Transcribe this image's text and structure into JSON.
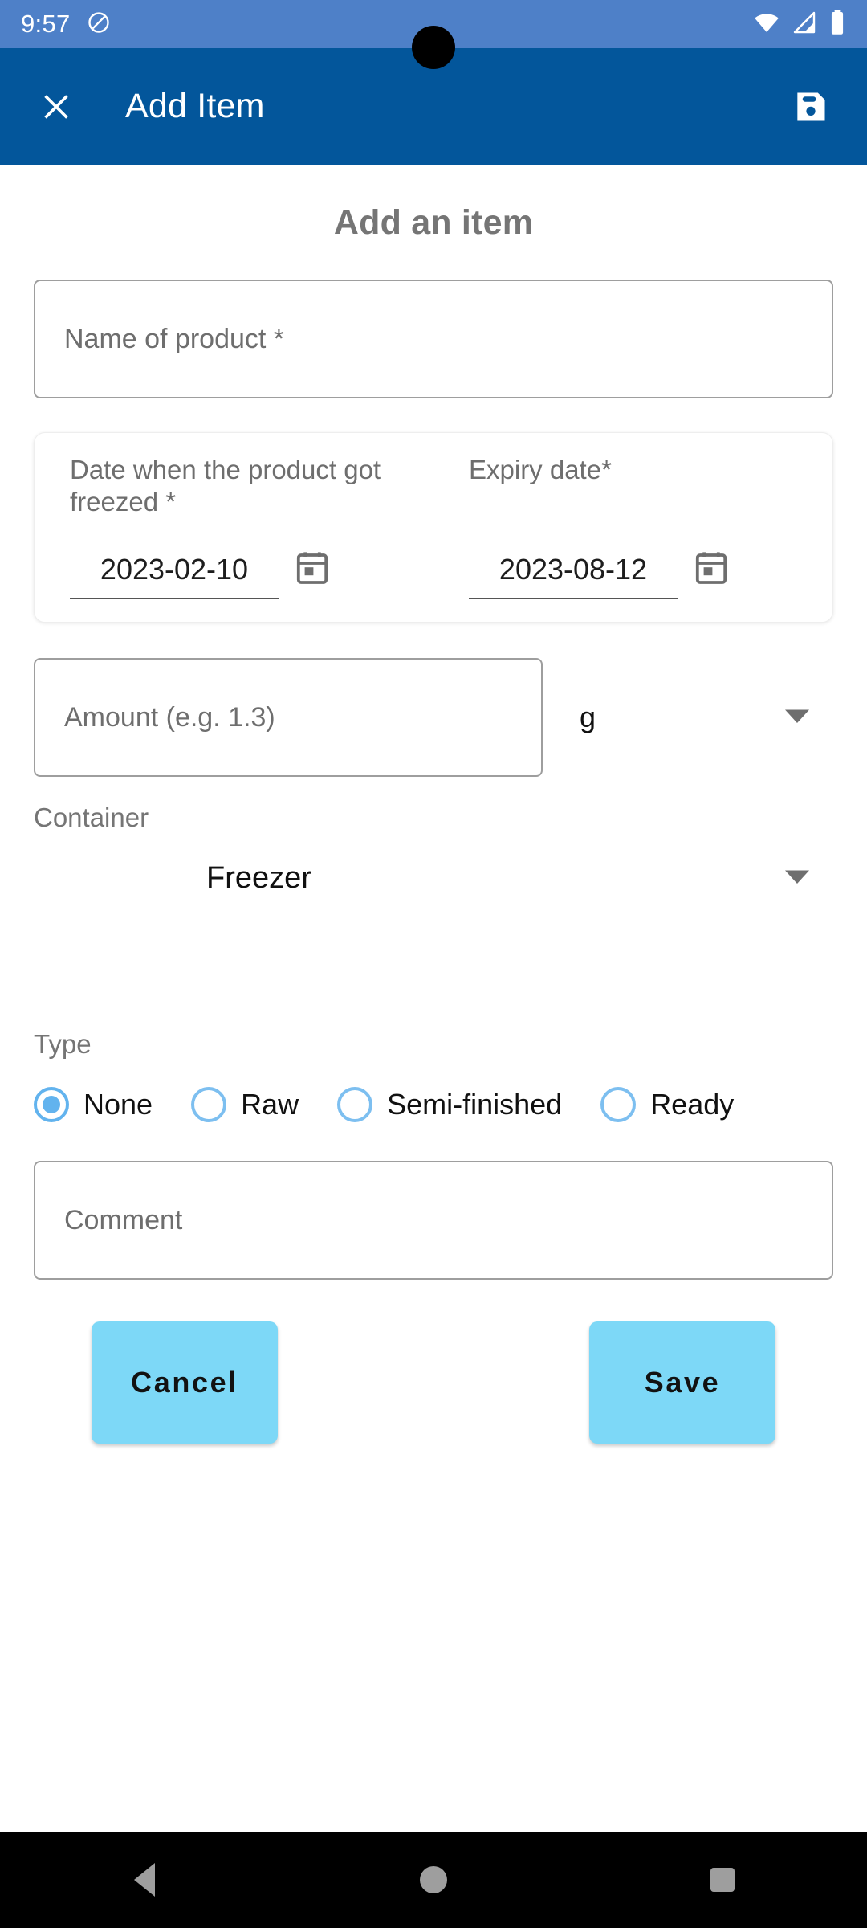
{
  "status_bar": {
    "time": "9:57",
    "icons": [
      "do-not-disturb-icon",
      "wifi-icon",
      "cellular-signal-icon",
      "battery-icon"
    ],
    "background_color": "#4E80C8"
  },
  "app_bar": {
    "close_icon": "close-icon",
    "title": "Add Item",
    "save_icon": "save-icon",
    "background_color": "#03569B"
  },
  "form": {
    "title": "Add an item",
    "name_field": {
      "placeholder": "Name of product *",
      "value": ""
    },
    "freeze_date": {
      "label": "Date when the product got freezed *",
      "value": "2023-02-10",
      "icon": "calendar-icon"
    },
    "expiry_date": {
      "label": "Expiry date*",
      "value": "2023-08-12",
      "icon": "calendar-icon"
    },
    "amount": {
      "placeholder": "Amount (e.g. 1.3)",
      "value": ""
    },
    "unit": {
      "selected": "g",
      "arrow_icon": "chevron-down-icon"
    },
    "container": {
      "label": "Container",
      "selected": "Freezer",
      "arrow_icon": "chevron-down-icon"
    },
    "type": {
      "label": "Type",
      "selected": "None",
      "options": [
        {
          "label": "None",
          "checked": true
        },
        {
          "label": "Raw",
          "checked": false
        },
        {
          "label": "Semi-finished",
          "checked": false
        },
        {
          "label": "Ready",
          "checked": false
        }
      ],
      "accent_color": "#62B3EE"
    },
    "comment": {
      "placeholder": "Comment",
      "value": ""
    },
    "cancel_label": "Cancel",
    "save_label": "Save",
    "button_color": "#7DD8F7"
  },
  "nav_bar": {
    "back": "back-icon",
    "home": "home-icon",
    "recents": "recents-icon"
  }
}
